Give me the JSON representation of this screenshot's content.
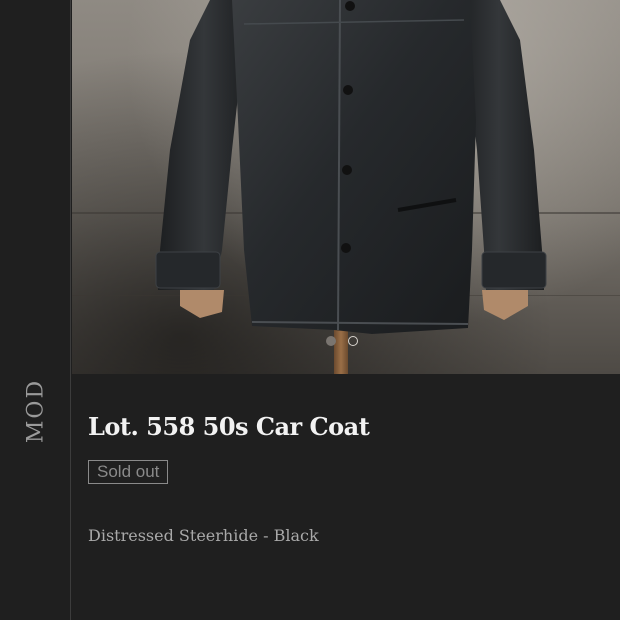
{
  "brand": {
    "text": "MOD"
  },
  "gallery": {
    "image_subject": "black leather car coat on mannequin",
    "slide_count": 2,
    "active_slide": 1
  },
  "product": {
    "title": "Lot. 558 50s Car Coat",
    "status_badge": "Sold out",
    "description": "Distressed Steerhide - Black"
  },
  "colors": {
    "background": "#1f1f1f",
    "title_text": "#f2f2f2",
    "muted_text": "#a9a9a9",
    "badge": "#8a8a8a"
  }
}
